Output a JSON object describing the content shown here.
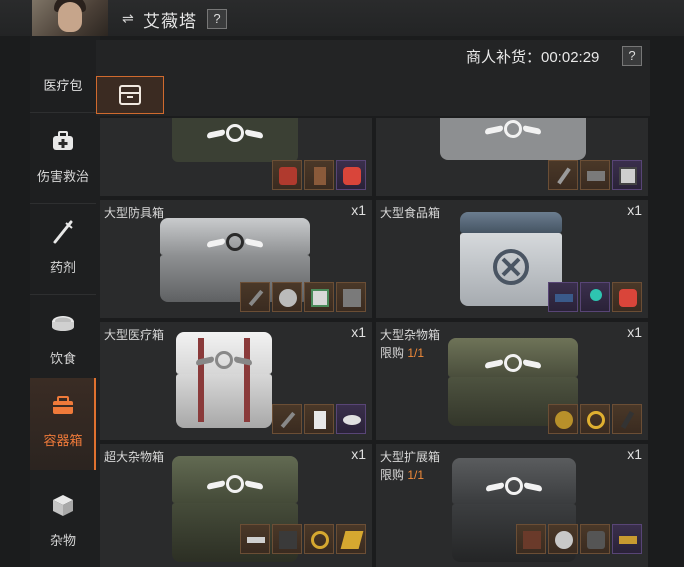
{
  "header": {
    "character_name": "艾薇塔",
    "help_label": "?",
    "swap_icon": "swap-icon"
  },
  "restock": {
    "label": "商人补货：00:02:29",
    "help_label": "?"
  },
  "categories": {
    "top_label": "医疗包",
    "items": [
      {
        "label": "伤害救治",
        "icon": "medkit-icon"
      },
      {
        "label": "药剂",
        "icon": "syringe-icon"
      },
      {
        "label": "饮食",
        "icon": "food-can-icon"
      },
      {
        "label": "容器箱",
        "icon": "container-icon",
        "active": true
      },
      {
        "label": "杂物",
        "icon": "misc-box-icon"
      }
    ]
  },
  "tab": {
    "icon": "container-tab-icon"
  },
  "cards": [
    {
      "title": "",
      "qty": "",
      "limit": "",
      "rewards": [
        "red-kit",
        "clock",
        "red-box"
      ],
      "colors": {
        "chest": "#3c4236"
      }
    },
    {
      "title": "",
      "qty": "",
      "limit": "",
      "rewards": [
        "pen",
        "tool",
        "tablet"
      ],
      "colors": {
        "chest": "#8a8c8e"
      }
    },
    {
      "title": "大型防具箱",
      "qty": "x1",
      "limit": "",
      "rewards": [
        "knife",
        "gauge",
        "document",
        "plate"
      ]
    },
    {
      "title": "大型食品箱",
      "qty": "x1",
      "limit": "",
      "rewards": [
        "ration",
        "key",
        "red-box"
      ]
    },
    {
      "title": "大型医疗箱",
      "qty": "x1",
      "limit": "",
      "rewards": [
        "syringe",
        "bottle",
        "disc"
      ]
    },
    {
      "title": "大型杂物箱",
      "qty": "x1",
      "limit_prefix": "限购",
      "limit_value": "1/1",
      "rewards": [
        "coin",
        "ring",
        "tool"
      ]
    },
    {
      "title": "超大杂物箱",
      "qty": "x1",
      "limit": "",
      "rewards": [
        "cigarette",
        "device",
        "ring",
        "gold-bar"
      ]
    },
    {
      "title": "大型扩展箱",
      "qty": "x1",
      "limit_prefix": "限购",
      "limit_value": "1/1",
      "rewards": [
        "chest",
        "gauge",
        "camera",
        "gun"
      ]
    }
  ],
  "colors": {
    "accent": "#e0712f",
    "limit_accent": "#f08a3a",
    "card_bg": "#2a2b2c"
  }
}
